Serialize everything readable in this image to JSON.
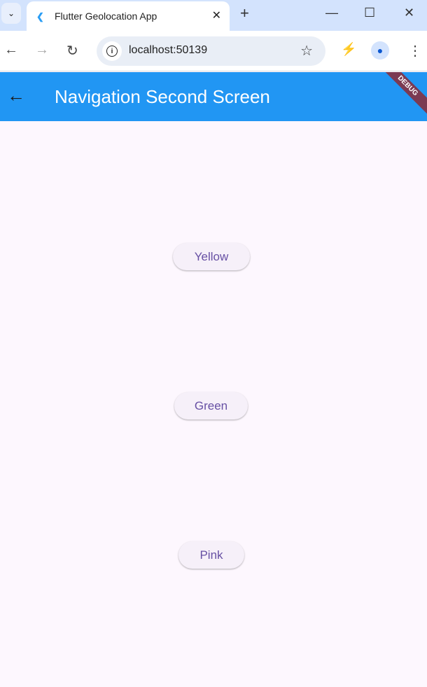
{
  "browser": {
    "tab_title": "Flutter Geolocation App",
    "url": "localhost:50139"
  },
  "app": {
    "title": "Navigation Second Screen",
    "debug_banner": "DEBUG",
    "color": "#2196f3"
  },
  "buttons": [
    {
      "label": "Yellow"
    },
    {
      "label": "Green"
    },
    {
      "label": "Pink"
    }
  ]
}
